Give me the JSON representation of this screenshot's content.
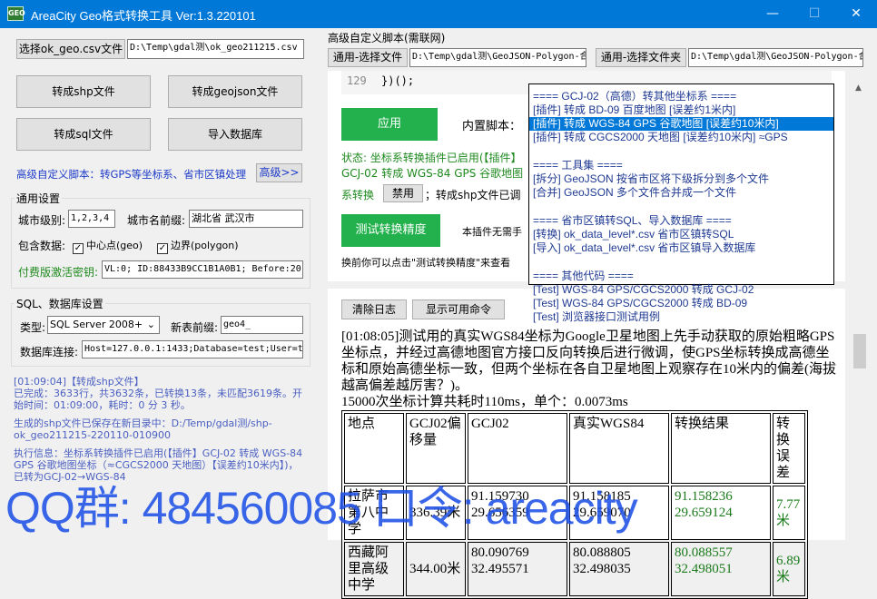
{
  "window": {
    "title": "AreaCity Geo格式转换工具 Ver:1.3.220101",
    "icon_label": "GEO",
    "controls": [
      "—",
      "☐",
      "✕"
    ]
  },
  "left": {
    "select_csv_button": "选择ok_geo.csv文件",
    "csv_path": "D:\\Temp\\gdal测\\ok_geo211215.csv",
    "btn_shp": "转成shp文件",
    "btn_geojson": "转成geojson文件",
    "btn_sql": "转成sql文件",
    "btn_import": "导入数据库",
    "advanced_hint": "高级自定义脚本：转GPS等坐标系、省市区镇处理",
    "advanced_button": "高级>>",
    "general": {
      "title": "通用设置",
      "city_level_label": "城市级别:",
      "city_level_value": "1,2,3,4",
      "city_prefix_label": "城市名前缀:",
      "city_prefix_value": "湖北省 武汉市",
      "include_label": "包含数据:",
      "center_label": "中心点(geo)",
      "boundary_label": "边界(polygon)",
      "license_label": "付费版激活密钥:",
      "license_value": "VL:0; ID:88433B9CC1B1A0B1; Before:20"
    },
    "db": {
      "title": "SQL、数据库设置",
      "type_label": "类型:",
      "type_value": "SQL Server 2008+",
      "new_table_label": "新表前缀:",
      "new_table_value": "geo4_",
      "conn_label": "数据库连接:",
      "conn_value": "Host=127.0.0.1:1433;Database=test;User=t"
    },
    "log": [
      "[01:09:04]【转成shp文件】\n已完成：3633行，共3632条，已转换13条，未匹配3619条。开始时间：01:09:00，耗时：0 分 3 秒。",
      "生成的shp文件已保存在新目录中：D:/Temp/gdal测/shp-ok_geo211215-220110-010900",
      "执行信息：坐标系转换插件已启用(【插件】GCJ-02 转成 WGS-84 GPS 谷歌地图坐标（≈CGCS2000 天地图）【误差约10米内】)，已转为GCJ-02→WGS-84"
    ]
  },
  "right": {
    "section_title": "高级自定义脚本(需联网)",
    "select1_button": "通用-选择文件",
    "path1": "D:\\Temp\\gdal测\\GeoJSON-Polygon-合",
    "select2_button": "通用-选择文件夹",
    "path2": "D:\\Temp\\gdal测\\GeoJSON-Polygon-合",
    "code_line_no": "129",
    "code_text": "})();",
    "apply_button": "应用",
    "builtin_label": "内置脚本：",
    "status_text": "状态: 坐标系转换插件已启用(【插件】GCJ-02 转成 WGS-84 GPS 谷歌地图坐标（≈CGCS2000 天地图）【误差约10米内】)",
    "disable_prefix": "系转换",
    "disable_button": "禁用",
    "disable_suffix": "；转成shp文件已调",
    "test_button": "测试转换精度",
    "test_hint": "本插件无需手",
    "test_note": "换前你可以点击\"测试转换精度\"来查看",
    "clear_log_button": "清除日志",
    "show_cmds_button": "显示可用命令"
  },
  "dropdown": {
    "items": [
      {
        "text": "==== GCJ-02（高德）转其他坐标系 ===="
      },
      {
        "text": "[插件] 转成 BD-09 百度地图 [误差约1米内]"
      },
      {
        "text": "[插件] 转成 WGS-84 GPS 谷歌地图 [误差约10米内]",
        "selected": true
      },
      {
        "text": "[插件] 转成 CGCS2000 天地图 [误差约10米内] ≈GPS"
      },
      {
        "gap": true
      },
      {
        "text": "==== 工具集 ===="
      },
      {
        "text": "[拆分] GeoJSON 按省市区将下级拆分到多个文件"
      },
      {
        "text": "[合并] GeoJSON 多个文件合并成一个文件"
      },
      {
        "gap": true
      },
      {
        "text": "==== 省市区镇转SQL、导入数据库 ===="
      },
      {
        "text": "[转换] ok_data_level*.csv 省市区镇转SQL"
      },
      {
        "text": "[导入] ok_data_level*.csv 省市区镇导入数据库"
      },
      {
        "gap": true
      },
      {
        "text": "==== 其他代码 ===="
      },
      {
        "text": "[Test] WGS-84 GPS/CGCS2000 转成 GCJ-02"
      },
      {
        "text": "[Test] WGS-84 GPS/CGCS2000 转成 BD-09"
      },
      {
        "text": "[Test] 浏览器接口测试用例"
      }
    ]
  },
  "article": {
    "para": "[01:08:05]测试用的真实WGS84坐标为Google卫星地图上先手动获取的原始粗略GPS坐标点，并经过高德地图官方接口反向转换后进行微调，使GPS坐标转换成高德坐标和原始高德坐标一致，但两个坐标在各自卫星地图上观察存在10米内的偏差(海拔越高偏差越厉害？)。",
    "summary": "15000次坐标计算共耗时110ms，单个：0.0073ms",
    "headers": [
      "地点",
      "GCJ02偏移量",
      "GCJ02",
      "真实WGS84",
      "转换结果",
      "转换误差"
    ],
    "rows": [
      [
        "拉萨市第八中学",
        "336.39米",
        "91.159730\n29.656359",
        "91.158185\n29.659070",
        "91.158236\n29.659124",
        "7.77米"
      ],
      [
        "西藏阿里高级中学",
        "344.00米",
        "80.090769\n32.495571",
        "80.088805\n32.498035",
        "80.088557\n32.498051",
        "6.89米"
      ]
    ]
  },
  "watermark": "QQ群: 484560085 口令: areacity"
}
